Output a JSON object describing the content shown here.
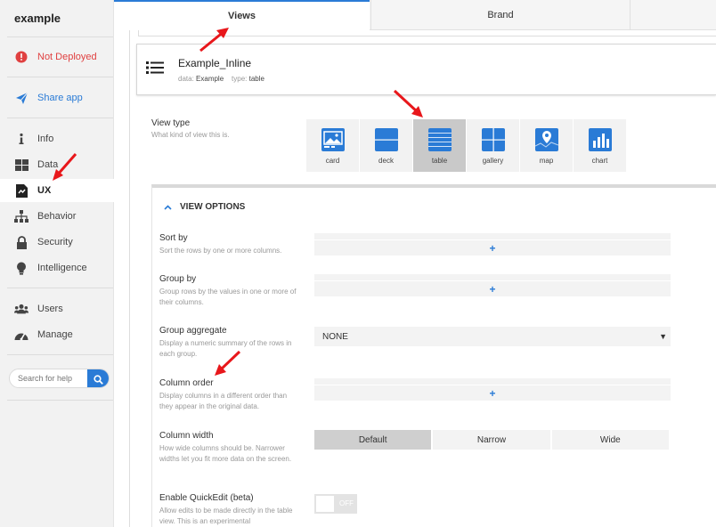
{
  "app": {
    "name": "example"
  },
  "sidebar": {
    "deploy_status": "Not Deployed",
    "share": "Share app",
    "items": [
      {
        "label": "Info",
        "icon": "info-icon"
      },
      {
        "label": "Data",
        "icon": "grid-icon"
      },
      {
        "label": "UX",
        "icon": "ux-icon"
      },
      {
        "label": "Behavior",
        "icon": "sitemap-icon"
      },
      {
        "label": "Security",
        "icon": "lock-icon"
      },
      {
        "label": "Intelligence",
        "icon": "bulb-icon"
      },
      {
        "label": "Users",
        "icon": "users-icon"
      },
      {
        "label": "Manage",
        "icon": "gauge-icon"
      }
    ],
    "search_placeholder": "Search for help"
  },
  "tabs": [
    {
      "label": "Views"
    },
    {
      "label": "Brand"
    },
    {
      "label": ""
    }
  ],
  "view": {
    "name": "Example_Inline",
    "data_key": "data:",
    "data_value": "Example",
    "type_key": "type:",
    "type_value": "table"
  },
  "view_type": {
    "label": "View type",
    "description": "What kind of view this is.",
    "options": [
      "card",
      "deck",
      "table",
      "gallery",
      "map",
      "chart"
    ],
    "selected": "table"
  },
  "view_options": {
    "header": "VIEW OPTIONS",
    "sort_by": {
      "label": "Sort by",
      "desc": "Sort the rows by one or more columns.",
      "add": "+"
    },
    "group_by": {
      "label": "Group by",
      "desc": "Group rows by the values in one or more of their columns.",
      "add": "+"
    },
    "group_aggregate": {
      "label": "Group aggregate",
      "desc": "Display a numeric summary of the rows in each group.",
      "value": "NONE"
    },
    "column_order": {
      "label": "Column order",
      "desc": "Display columns in a different order than they appear in the original data.",
      "add": "+"
    },
    "column_width": {
      "label": "Column width",
      "desc": "How wide columns should be. Narrower widths let you fit more data on the screen.",
      "options": [
        "Default",
        "Narrow",
        "Wide"
      ],
      "selected": "Default"
    },
    "quickedit": {
      "label": "Enable QuickEdit (beta)",
      "desc": "Allow edits to be made directly in the table view. This is an experimental",
      "state": "OFF"
    }
  },
  "colors": {
    "accent": "#2a7bd6",
    "annotation": "#e8171b",
    "warning": "#e04040"
  }
}
